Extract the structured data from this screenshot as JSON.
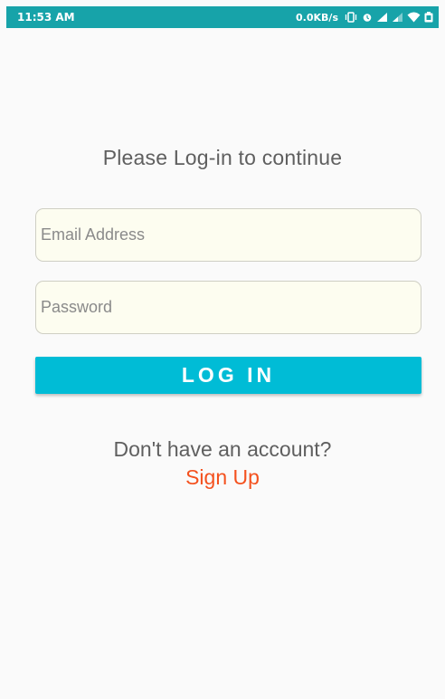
{
  "status_bar": {
    "time": "11:53 AM",
    "net_speed": "0.0KB/s",
    "icons": [
      "vibrate-icon",
      "alarm-icon",
      "signal-icon",
      "signal-weak-icon",
      "wifi-icon",
      "battery-icon"
    ],
    "color": "#17a3a9"
  },
  "login": {
    "heading": "Please Log-in to continue",
    "email": {
      "placeholder": "Email Address",
      "value": ""
    },
    "password": {
      "placeholder": "Password",
      "value": ""
    },
    "login_button_label": "LOG IN",
    "signup_prompt": "Don't have an account?",
    "signup_link": "Sign Up"
  },
  "colors": {
    "accent": "#00bcd6",
    "link": "#f4511e",
    "text": "#5f5f5f",
    "field_background": "#fdfdf0"
  }
}
